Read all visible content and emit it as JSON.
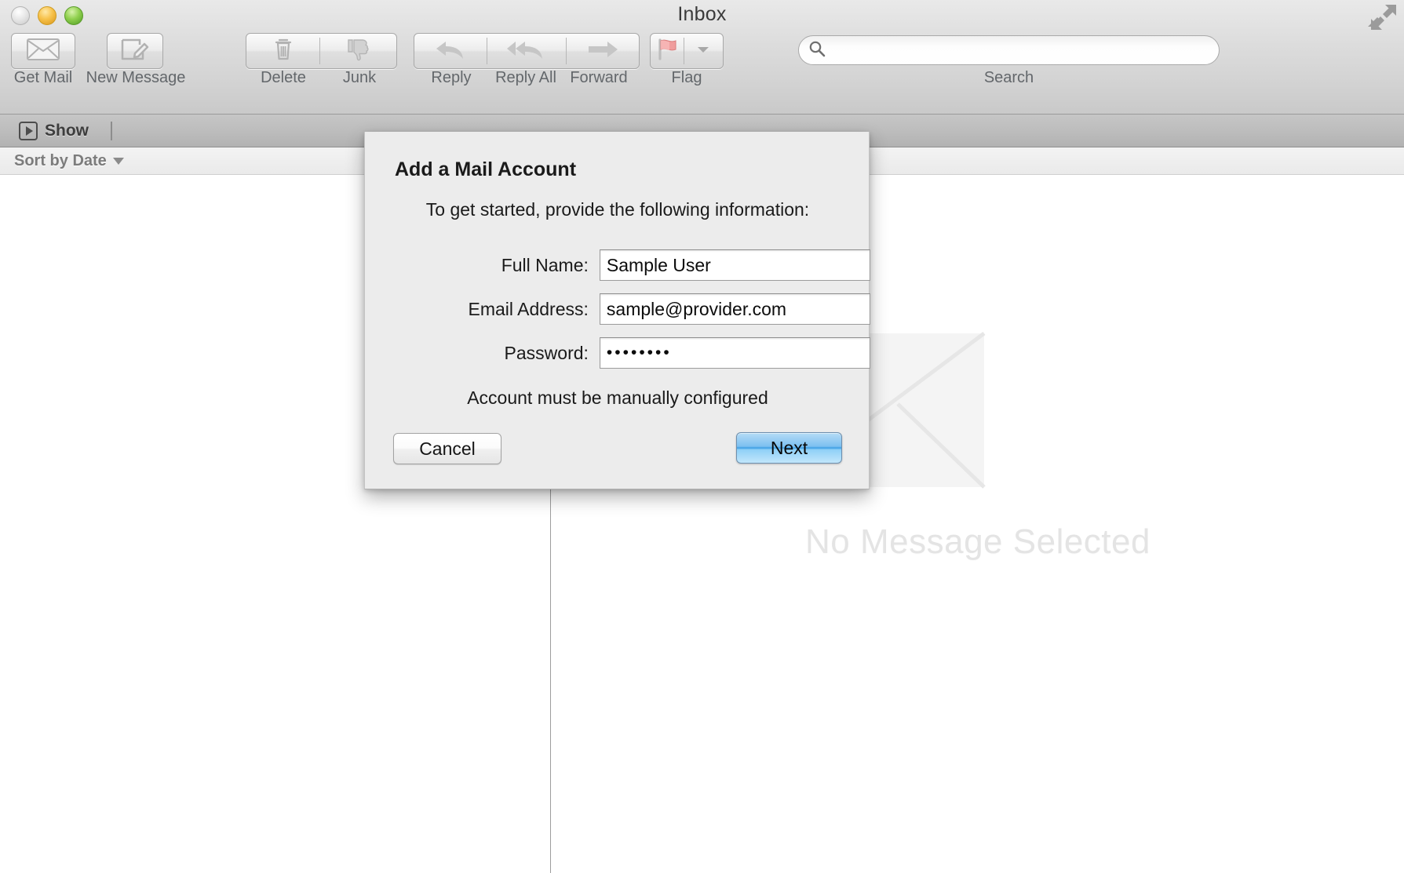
{
  "window": {
    "title": "Inbox",
    "traffic_lights": [
      "close",
      "minimize",
      "maximize"
    ],
    "fullscreen_icon": "fullscreen-arrows-icon"
  },
  "toolbar": {
    "items": [
      {
        "label": "Get Mail",
        "icon": "envelope-icon"
      },
      {
        "label": "New Message",
        "icon": "compose-pencil-icon"
      },
      {
        "label": "Delete",
        "icon": "trash-icon"
      },
      {
        "label": "Junk",
        "icon": "thumbs-down-icon"
      },
      {
        "label": "Reply",
        "icon": "reply-arrow-icon"
      },
      {
        "label": "Reply All",
        "icon": "reply-all-arrow-icon"
      },
      {
        "label": "Forward",
        "icon": "forward-arrow-icon"
      },
      {
        "label": "Flag",
        "icon": "red-flag-icon"
      }
    ],
    "flag_menu_icon": "chevron-down-icon"
  },
  "search": {
    "label": "Search",
    "placeholder": "",
    "value": "",
    "icon": "search-icon"
  },
  "showbar": {
    "show_label": "Show",
    "show_icon": "play-in-box-icon"
  },
  "message_list": {
    "sort_label": "Sort by Date",
    "sort_caret_icon": "chevron-down-icon",
    "rows": []
  },
  "reading_pane": {
    "empty_text": "No Message Selected",
    "watermark_icon": "envelope-outline-watermark-icon"
  },
  "dialog": {
    "title": "Add a Mail Account",
    "subtitle": "To get started, provide the following information:",
    "fields": [
      {
        "label": "Full Name:",
        "value": "Sample User",
        "type": "text",
        "name": "full-name"
      },
      {
        "label": "Email Address:",
        "value": "sample@provider.com",
        "type": "text",
        "name": "email-address"
      },
      {
        "label": "Password:",
        "value": "••••••••",
        "type": "password",
        "name": "password"
      }
    ],
    "note": "Account must be manually configured",
    "cancel_label": "Cancel",
    "next_label": "Next"
  },
  "colors": {
    "accent_blue": "#3d9ee4",
    "toolbar_gray": "#d6d6d6",
    "sheet_gray": "#ececec",
    "flag_red": "#ef8b8b",
    "watermark_gray": "#f0f0f0"
  }
}
